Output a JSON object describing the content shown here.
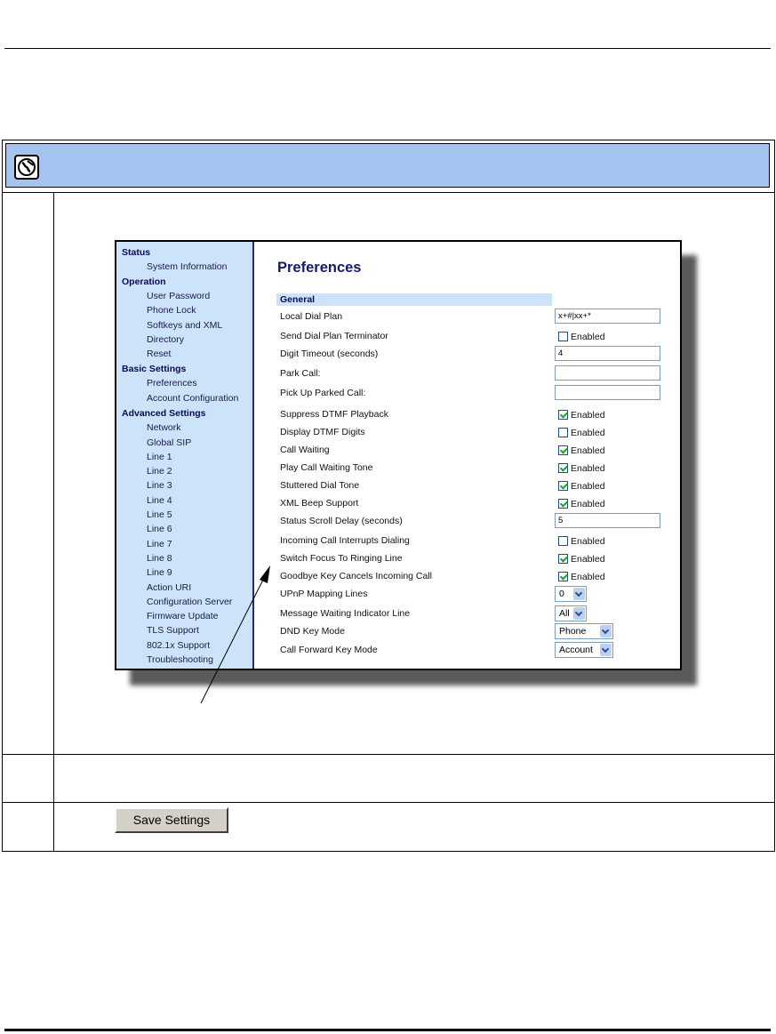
{
  "sidebar": {
    "items": [
      {
        "label": "Status",
        "type": "section"
      },
      {
        "label": "System Information",
        "type": "item"
      },
      {
        "label": "Operation",
        "type": "section"
      },
      {
        "label": "User Password",
        "type": "item"
      },
      {
        "label": "Phone Lock",
        "type": "item"
      },
      {
        "label": "Softkeys and XML",
        "type": "item"
      },
      {
        "label": "Directory",
        "type": "item"
      },
      {
        "label": "Reset",
        "type": "item"
      },
      {
        "label": "Basic Settings",
        "type": "section"
      },
      {
        "label": "Preferences",
        "type": "item"
      },
      {
        "label": "Account Configuration",
        "type": "item"
      },
      {
        "label": "Advanced Settings",
        "type": "section"
      },
      {
        "label": "Network",
        "type": "item"
      },
      {
        "label": "Global SIP",
        "type": "item"
      },
      {
        "label": "Line 1",
        "type": "item"
      },
      {
        "label": "Line 2",
        "type": "item"
      },
      {
        "label": "Line 3",
        "type": "item"
      },
      {
        "label": "Line 4",
        "type": "item"
      },
      {
        "label": "Line 5",
        "type": "item"
      },
      {
        "label": "Line 6",
        "type": "item"
      },
      {
        "label": "Line 7",
        "type": "item"
      },
      {
        "label": "Line 8",
        "type": "item"
      },
      {
        "label": "Line 9",
        "type": "item"
      },
      {
        "label": "Action URI",
        "type": "item"
      },
      {
        "label": "Configuration Server",
        "type": "item"
      },
      {
        "label": "Firmware Update",
        "type": "item"
      },
      {
        "label": "TLS Support",
        "type": "item"
      },
      {
        "label": "802.1x Support",
        "type": "item"
      },
      {
        "label": "Troubleshooting",
        "type": "item"
      }
    ]
  },
  "page": {
    "title": "Preferences",
    "section": "General",
    "enabled_label": "Enabled",
    "rows": [
      {
        "label": "Local Dial Plan",
        "kind": "text",
        "value": "x+#|xx+*"
      },
      {
        "label": "Send Dial Plan Terminator",
        "kind": "checkbox",
        "checked": false
      },
      {
        "label": "Digit Timeout (seconds)",
        "kind": "text",
        "value": "4"
      },
      {
        "label": "Park Call:",
        "kind": "text",
        "value": ""
      },
      {
        "label": "Pick Up Parked Call:",
        "kind": "text",
        "value": ""
      },
      {
        "label": "Suppress DTMF Playback",
        "kind": "checkbox",
        "checked": true
      },
      {
        "label": "Display DTMF Digits",
        "kind": "checkbox",
        "checked": false
      },
      {
        "label": "Call Waiting",
        "kind": "checkbox",
        "checked": true
      },
      {
        "label": "Play Call Waiting Tone",
        "kind": "checkbox",
        "checked": true
      },
      {
        "label": "Stuttered Dial Tone",
        "kind": "checkbox",
        "checked": true
      },
      {
        "label": "XML Beep Support",
        "kind": "checkbox",
        "checked": true
      },
      {
        "label": "Status Scroll Delay (seconds)",
        "kind": "text",
        "value": "5"
      },
      {
        "label": "Incoming Call Interrupts Dialing",
        "kind": "checkbox",
        "checked": false
      },
      {
        "label": "Switch Focus To Ringing Line",
        "kind": "checkbox",
        "checked": true
      },
      {
        "label": "Goodbye Key Cancels Incoming Call",
        "kind": "checkbox",
        "checked": true
      },
      {
        "label": "UPnP Mapping Lines",
        "kind": "select",
        "value": "0"
      },
      {
        "label": "Message Waiting Indicator Line",
        "kind": "select",
        "value": "All"
      },
      {
        "label": "DND Key Mode",
        "kind": "select",
        "value": "Phone"
      },
      {
        "label": "Call Forward Key Mode",
        "kind": "select",
        "value": "Account"
      }
    ]
  },
  "save_button": {
    "label": "Save Settings"
  },
  "icons": {
    "header": "globe-icon"
  },
  "colors": {
    "header_bar": "#a4c3ef",
    "sidebar_bg": "#cde3f9",
    "title": "#141a6e"
  }
}
